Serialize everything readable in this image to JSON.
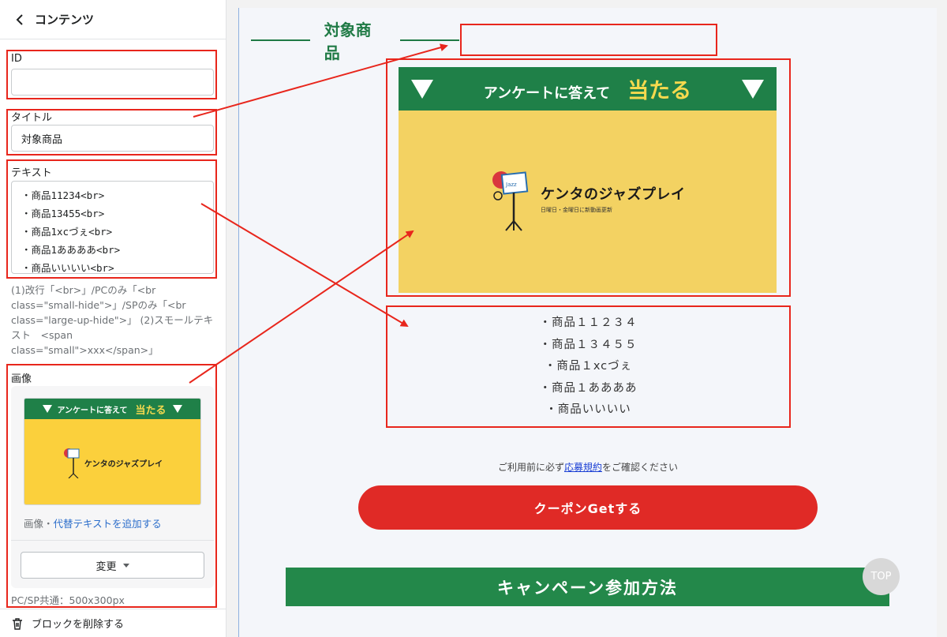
{
  "sidebar": {
    "title": "コンテンツ",
    "id_label": "ID",
    "id_value": "",
    "title_label": "タイトル",
    "title_value": "対象商品",
    "text_label": "テキスト",
    "text_lines": [
      "・商品11234<br>",
      "・商品13455<br>",
      "・商品1xcづぇ<br>",
      "・商品1ああああ<br>",
      "・商品いいいい<br>"
    ],
    "help_text": "(1)改行「<br>」/PCのみ「<br class=\"small-hide\">」/SPのみ「<br class=\"large-up-hide\">」 (2)スモールテキスト　<span class=\"small\">xxx</span>」",
    "image_label": "画像",
    "thumb_banner_text": "アンケートに答えて",
    "thumb_banner_highlight": "当たる",
    "thumb_logo_text": "ケンタのジャズプレイ",
    "image_caption_prefix": "画像・",
    "image_caption_link": "代替テキストを追加する",
    "change_button": "変更",
    "size_note": "PC/SP共通：500x300px",
    "delete_block": "ブロックを削除する"
  },
  "preview": {
    "section_title": "対象商品",
    "banner_text": "アンケートに答えて",
    "banner_highlight": "当たる",
    "logo_name": "ケンタのジャズプレイ",
    "logo_sub": "日曜日・金曜日に新動画更新",
    "logo_note_text": "Jazz",
    "products": [
      "・商品１１２３４",
      "・商品１３４５５",
      "・商品１xcづぇ",
      "・商品１ああああ",
      "・商品いいいい"
    ],
    "notice_prefix": "ご利用前に必ず",
    "notice_link": "応募規約",
    "notice_suffix": "をご確認ください",
    "coupon_button": "クーポンGetする",
    "campaign_heading": "キャンペーン参加方法",
    "top_button": "TOP"
  },
  "colors": {
    "annotation_red": "#e8261c",
    "brand_green": "#1f8048",
    "banner_yellow": "#f3d262",
    "coupon_red": "#e02a26",
    "link_blue": "#2c6ecb"
  },
  "icons": {
    "back": "chevron-left-icon",
    "delete": "trash-icon",
    "dropdown": "caret-down-icon"
  }
}
